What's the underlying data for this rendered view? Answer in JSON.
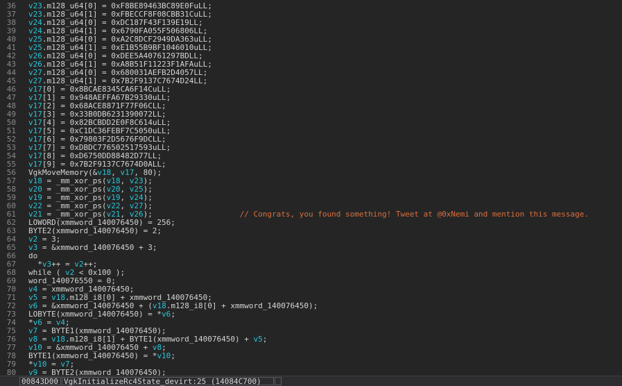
{
  "lines": [
    {
      "n": "36",
      "parts": [
        [
          "v",
          "v23"
        ],
        [
          "p",
          ".m128_u64[0] = 0xF8BE89463BC89E0FuLL;"
        ]
      ]
    },
    {
      "n": "37",
      "parts": [
        [
          "v",
          "v23"
        ],
        [
          "p",
          ".m128_u64[1] = 0xFBECCF8F08CBB31CuLL;"
        ]
      ]
    },
    {
      "n": "38",
      "parts": [
        [
          "v",
          "v24"
        ],
        [
          "p",
          ".m128_u64[0] = 0xDC187F43F139E19LL;"
        ]
      ]
    },
    {
      "n": "39",
      "parts": [
        [
          "v",
          "v24"
        ],
        [
          "p",
          ".m128_u64[1] = 0x6790FA055F506806LL;"
        ]
      ]
    },
    {
      "n": "40",
      "parts": [
        [
          "v",
          "v25"
        ],
        [
          "p",
          ".m128_u64[0] = 0xA2C8DCF2949DA363uLL;"
        ]
      ]
    },
    {
      "n": "41",
      "parts": [
        [
          "v",
          "v25"
        ],
        [
          "p",
          ".m128_u64[1] = 0xE1B55B9BF1046010uLL;"
        ]
      ]
    },
    {
      "n": "42",
      "parts": [
        [
          "v",
          "v26"
        ],
        [
          "p",
          ".m128_u64[0] = 0xDEE5A40761297BDLL;"
        ]
      ]
    },
    {
      "n": "43",
      "parts": [
        [
          "v",
          "v26"
        ],
        [
          "p",
          ".m128_u64[1] = 0xA8B51F11223F1AFAuLL;"
        ]
      ]
    },
    {
      "n": "44",
      "parts": [
        [
          "v",
          "v27"
        ],
        [
          "p",
          ".m128_u64[0] = 0x680031AEFB2D4057LL;"
        ]
      ]
    },
    {
      "n": "45",
      "parts": [
        [
          "v",
          "v27"
        ],
        [
          "p",
          ".m128_u64[1] = 0x7B2F9137C7674D24LL;"
        ]
      ]
    },
    {
      "n": "46",
      "parts": [
        [
          "v",
          "v17"
        ],
        [
          "p",
          "[0] = 0x8BCAE8345CA6F14CuLL;"
        ]
      ]
    },
    {
      "n": "47",
      "parts": [
        [
          "v",
          "v17"
        ],
        [
          "p",
          "[1] = 0x948AEFFA67B29330uLL;"
        ]
      ]
    },
    {
      "n": "48",
      "parts": [
        [
          "v",
          "v17"
        ],
        [
          "p",
          "[2] = 0x68ACE8871F77F06CLL;"
        ]
      ]
    },
    {
      "n": "49",
      "parts": [
        [
          "v",
          "v17"
        ],
        [
          "p",
          "[3] = 0x33B0DB6231390072LL;"
        ]
      ]
    },
    {
      "n": "50",
      "parts": [
        [
          "v",
          "v17"
        ],
        [
          "p",
          "[4] = 0x82BCBDD2E0F8C614uLL;"
        ]
      ]
    },
    {
      "n": "51",
      "parts": [
        [
          "v",
          "v17"
        ],
        [
          "p",
          "[5] = 0xC1DC36FEBF7C5050uLL;"
        ]
      ]
    },
    {
      "n": "52",
      "parts": [
        [
          "v",
          "v17"
        ],
        [
          "p",
          "[6] = 0x79803F2D5676F9DCLL;"
        ]
      ]
    },
    {
      "n": "53",
      "parts": [
        [
          "v",
          "v17"
        ],
        [
          "p",
          "[7] = 0xDBDC776502517593uLL;"
        ]
      ]
    },
    {
      "n": "54",
      "parts": [
        [
          "v",
          "v17"
        ],
        [
          "p",
          "[8] = 0xD6750DD88482D77LL;"
        ]
      ]
    },
    {
      "n": "55",
      "parts": [
        [
          "v",
          "v17"
        ],
        [
          "p",
          "[9] = 0x7B2F9137C7674D0ALL;"
        ]
      ]
    },
    {
      "n": "56",
      "parts": [
        [
          "p",
          "VgkMoveMemory(&"
        ],
        [
          "v",
          "v18"
        ],
        [
          "p",
          ", "
        ],
        [
          "v",
          "v17"
        ],
        [
          "p",
          ", 80);"
        ]
      ]
    },
    {
      "n": "57",
      "parts": [
        [
          "v",
          "v18"
        ],
        [
          "p",
          " = _mm_xor_ps("
        ],
        [
          "v",
          "v18"
        ],
        [
          "p",
          ", "
        ],
        [
          "v",
          "v23"
        ],
        [
          "p",
          ");"
        ]
      ]
    },
    {
      "n": "58",
      "parts": [
        [
          "v",
          "v20"
        ],
        [
          "p",
          " = _mm_xor_ps("
        ],
        [
          "v",
          "v20"
        ],
        [
          "p",
          ", "
        ],
        [
          "v",
          "v25"
        ],
        [
          "p",
          ");"
        ]
      ]
    },
    {
      "n": "59",
      "parts": [
        [
          "v",
          "v19"
        ],
        [
          "p",
          " = _mm_xor_ps("
        ],
        [
          "v",
          "v19"
        ],
        [
          "p",
          ", "
        ],
        [
          "v",
          "v24"
        ],
        [
          "p",
          ");"
        ]
      ]
    },
    {
      "n": "60",
      "parts": [
        [
          "v",
          "v22"
        ],
        [
          "p",
          " = _mm_xor_ps("
        ],
        [
          "v",
          "v22"
        ],
        [
          "p",
          ", "
        ],
        [
          "v",
          "v27"
        ],
        [
          "p",
          ");"
        ]
      ]
    },
    {
      "n": "61",
      "parts": [
        [
          "v",
          "v21"
        ],
        [
          "p",
          " = _mm_xor_ps("
        ],
        [
          "v",
          "v21"
        ],
        [
          "p",
          ", "
        ],
        [
          "v",
          "v26"
        ],
        [
          "p",
          ");"
        ],
        [
          "p",
          "                   "
        ],
        [
          "c",
          "// Congrats, you found something! Tweet at @0xNemi and mention this message."
        ]
      ]
    },
    {
      "n": "62",
      "parts": [
        [
          "p",
          "LOWORD(xmmword_140076450) = 256;"
        ]
      ]
    },
    {
      "n": "63",
      "parts": [
        [
          "p",
          "BYTE2(xmmword_140076450) = 2;"
        ]
      ]
    },
    {
      "n": "64",
      "parts": [
        [
          "v",
          "v2"
        ],
        [
          "p",
          " = 3;"
        ]
      ]
    },
    {
      "n": "65",
      "parts": [
        [
          "v",
          "v3"
        ],
        [
          "p",
          " = &xmmword_140076450 + 3;"
        ]
      ]
    },
    {
      "n": "66",
      "parts": [
        [
          "p",
          "do"
        ]
      ]
    },
    {
      "n": "67",
      "parts": [
        [
          "p",
          "  *"
        ],
        [
          "v",
          "v3"
        ],
        [
          "p",
          "++ = "
        ],
        [
          "v",
          "v2"
        ],
        [
          "p",
          "++;"
        ]
      ]
    },
    {
      "n": "68",
      "parts": [
        [
          "p",
          "while ( "
        ],
        [
          "v",
          "v2"
        ],
        [
          "p",
          " < 0x100 );"
        ]
      ]
    },
    {
      "n": "69",
      "parts": [
        [
          "p",
          "word_140076550 = 0;"
        ]
      ]
    },
    {
      "n": "70",
      "parts": [
        [
          "v",
          "v4"
        ],
        [
          "p",
          " = xmmword_140076450;"
        ]
      ]
    },
    {
      "n": "71",
      "parts": [
        [
          "v",
          "v5"
        ],
        [
          "p",
          " = "
        ],
        [
          "v",
          "v18"
        ],
        [
          "p",
          ".m128_i8[0] + xmmword_140076450;"
        ]
      ]
    },
    {
      "n": "72",
      "parts": [
        [
          "v",
          "v6"
        ],
        [
          "p",
          " = &xmmword_140076450 + ("
        ],
        [
          "v",
          "v18"
        ],
        [
          "p",
          ".m128_i8[0] + xmmword_140076450);"
        ]
      ]
    },
    {
      "n": "73",
      "parts": [
        [
          "p",
          "LOBYTE(xmmword_140076450) = *"
        ],
        [
          "v",
          "v6"
        ],
        [
          "p",
          ";"
        ]
      ]
    },
    {
      "n": "74",
      "parts": [
        [
          "p",
          "*"
        ],
        [
          "v",
          "v6"
        ],
        [
          "p",
          " = "
        ],
        [
          "v",
          "v4"
        ],
        [
          "p",
          ";"
        ]
      ]
    },
    {
      "n": "75",
      "parts": [
        [
          "v",
          "v7"
        ],
        [
          "p",
          " = BYTE1(xmmword_140076450);"
        ]
      ]
    },
    {
      "n": "76",
      "parts": [
        [
          "v",
          "v8"
        ],
        [
          "p",
          " = "
        ],
        [
          "v",
          "v18"
        ],
        [
          "p",
          ".m128_i8[1] + BYTE1(xmmword_140076450) + "
        ],
        [
          "v",
          "v5"
        ],
        [
          "p",
          ";"
        ]
      ]
    },
    {
      "n": "77",
      "parts": [
        [
          "v",
          "v10"
        ],
        [
          "p",
          " = &xmmword_140076450 + "
        ],
        [
          "v",
          "v8"
        ],
        [
          "p",
          ";"
        ]
      ]
    },
    {
      "n": "78",
      "parts": [
        [
          "p",
          "BYTE1(xmmword_140076450) = *"
        ],
        [
          "v",
          "v10"
        ],
        [
          "p",
          ";"
        ]
      ]
    },
    {
      "n": "79",
      "parts": [
        [
          "p",
          "*"
        ],
        [
          "v",
          "v10"
        ],
        [
          "p",
          " = "
        ],
        [
          "v",
          "v7"
        ],
        [
          "p",
          ";"
        ]
      ]
    },
    {
      "n": "80",
      "parts": [
        [
          "v",
          "v9"
        ],
        [
          "p",
          " = BYTE2(xmmword_140076450);"
        ]
      ]
    }
  ],
  "status": {
    "address": "00843D00",
    "location": "VgkInitializeRc4State_devirt:25 (14084C700)"
  },
  "colors": {
    "variable": "#27c6d8",
    "comment": "#d96f3b",
    "background": "#252526"
  }
}
